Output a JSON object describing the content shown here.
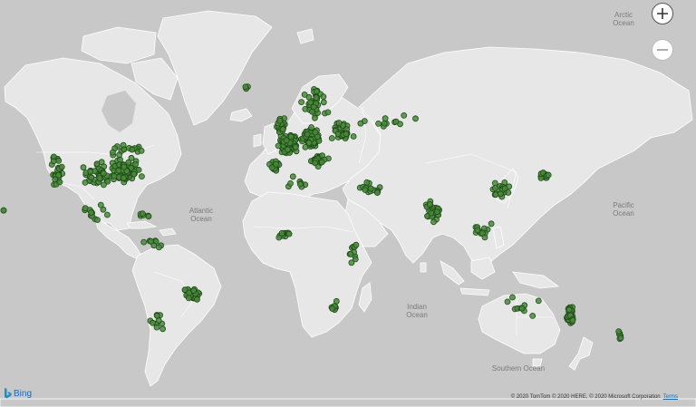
{
  "map": {
    "ocean_labels": [
      {
        "key": "arctic",
        "lines": [
          "Arctic",
          "Ocean"
        ]
      },
      {
        "key": "atlantic",
        "lines": [
          "Atlantic",
          "Ocean"
        ]
      },
      {
        "key": "pacific",
        "lines": [
          "Pacific",
          "Ocean"
        ]
      },
      {
        "key": "indian",
        "lines": [
          "Indian",
          "Ocean"
        ]
      },
      {
        "key": "southern",
        "lines": [
          "Southern Ocean"
        ]
      }
    ],
    "label_arctic_1": "Arctic",
    "label_arctic_2": "Ocean",
    "label_atlantic_1": "Atlantic",
    "label_atlantic_2": "Ocean",
    "label_pacific_1": "Pacific",
    "label_pacific_2": "Ocean",
    "label_indian_1": "Indian",
    "label_indian_2": "Ocean",
    "label_southern": "Southern Ocean",
    "point_color": "#4a8a3c",
    "point_stroke": "#1e4a18",
    "land_color": "#e7e7e7",
    "water_color": "#c8c8c8"
  },
  "controls": {
    "zoom_in_icon": "plus-icon",
    "zoom_out_icon": "minus-icon"
  },
  "branding": {
    "logo_icon": "bing-b-icon",
    "logo_text": "Bing",
    "attribution": "© 2020 TomTom © 2020 HERE, © 2020 Microsoft Corporation",
    "terms": "Terms"
  },
  "clusters": [
    {
      "name": "north-america-east",
      "lon": -82,
      "lat": 38,
      "spread_lon": 10,
      "spread_lat": 6,
      "count": 90
    },
    {
      "name": "north-america-west",
      "lon": -118,
      "lat": 38,
      "spread_lon": 6,
      "spread_lat": 8,
      "count": 30
    },
    {
      "name": "north-america-central",
      "lon": -97,
      "lat": 36,
      "spread_lon": 9,
      "spread_lat": 7,
      "count": 40
    },
    {
      "name": "canada",
      "lon": -80,
      "lat": 46,
      "spread_lon": 12,
      "spread_lat": 3,
      "count": 18
    },
    {
      "name": "mexico-central-america",
      "lon": -98,
      "lat": 19,
      "spread_lon": 8,
      "spread_lat": 5,
      "count": 14
    },
    {
      "name": "caribbean",
      "lon": -72,
      "lat": 18,
      "spread_lon": 6,
      "spread_lat": 2,
      "count": 6
    },
    {
      "name": "south-america-north",
      "lon": -68,
      "lat": 5,
      "spread_lon": 8,
      "spread_lat": 5,
      "count": 8
    },
    {
      "name": "brazil-south",
      "lon": -48,
      "lat": -22,
      "spread_lon": 5,
      "spread_lat": 5,
      "count": 30
    },
    {
      "name": "argentina-chile",
      "lon": -66,
      "lat": -34,
      "spread_lon": 5,
      "spread_lat": 6,
      "count": 10
    },
    {
      "name": "europe-west",
      "lon": 2,
      "lat": 48,
      "spread_lon": 6,
      "spread_lat": 5,
      "count": 90
    },
    {
      "name": "europe-central",
      "lon": 14,
      "lat": 50,
      "spread_lon": 6,
      "spread_lat": 4,
      "count": 110
    },
    {
      "name": "scandinavia",
      "lon": 16,
      "lat": 60,
      "spread_lon": 8,
      "spread_lat": 5,
      "count": 40
    },
    {
      "name": "iberia",
      "lon": -5,
      "lat": 40,
      "spread_lon": 4,
      "spread_lat": 3,
      "count": 18
    },
    {
      "name": "italy-balkans",
      "lon": 18,
      "lat": 42,
      "spread_lon": 5,
      "spread_lat": 3,
      "count": 30
    },
    {
      "name": "eastern-europe",
      "lon": 30,
      "lat": 52,
      "spread_lon": 7,
      "spread_lat": 4,
      "count": 30
    },
    {
      "name": "uk-ireland",
      "lon": -2,
      "lat": 54,
      "spread_lon": 3,
      "spread_lat": 3,
      "count": 35
    },
    {
      "name": "iceland",
      "lon": -20,
      "lat": 64,
      "spread_lon": 2,
      "spread_lat": 1,
      "count": 3
    },
    {
      "name": "russia",
      "lon": 55,
      "lat": 56,
      "spread_lon": 20,
      "spread_lat": 3,
      "count": 12
    },
    {
      "name": "middle-east",
      "lon": 45,
      "lat": 30,
      "spread_lon": 8,
      "spread_lat": 5,
      "count": 15
    },
    {
      "name": "india",
      "lon": 77,
      "lat": 20,
      "spread_lon": 5,
      "spread_lat": 7,
      "count": 40
    },
    {
      "name": "southeast-asia",
      "lon": 103,
      "lat": 10,
      "spread_lon": 7,
      "spread_lat": 6,
      "count": 14
    },
    {
      "name": "china",
      "lon": 113,
      "lat": 30,
      "spread_lon": 8,
      "spread_lat": 7,
      "count": 20
    },
    {
      "name": "japan-korea",
      "lon": 135,
      "lat": 36,
      "spread_lon": 5,
      "spread_lat": 3,
      "count": 12
    },
    {
      "name": "africa-west",
      "lon": 0,
      "lat": 8,
      "spread_lon": 8,
      "spread_lat": 3,
      "count": 10
    },
    {
      "name": "africa-east",
      "lon": 36,
      "lat": -2,
      "spread_lon": 3,
      "spread_lat": 6,
      "count": 10
    },
    {
      "name": "south-africa",
      "lon": 26,
      "lat": -28,
      "spread_lon": 4,
      "spread_lat": 3,
      "count": 8
    },
    {
      "name": "north-africa",
      "lon": 5,
      "lat": 33,
      "spread_lon": 10,
      "spread_lat": 3,
      "count": 8
    },
    {
      "name": "australia-east",
      "lon": 148,
      "lat": -32,
      "spread_lon": 3,
      "spread_lat": 5,
      "count": 35
    },
    {
      "name": "australia-other",
      "lon": 125,
      "lat": -28,
      "spread_lon": 12,
      "spread_lat": 6,
      "count": 10
    },
    {
      "name": "new-zealand",
      "lon": 174,
      "lat": -40,
      "spread_lon": 2,
      "spread_lat": 3,
      "count": 6
    },
    {
      "name": "hawaii",
      "lon": -156,
      "lat": 20,
      "spread_lon": 1,
      "spread_lat": 0.5,
      "count": 2
    }
  ]
}
